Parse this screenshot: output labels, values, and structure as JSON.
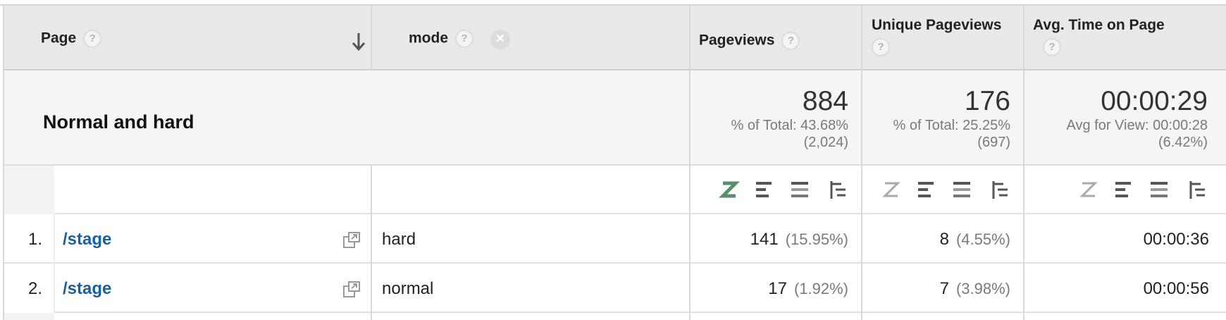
{
  "columns": {
    "page": "Page",
    "mode": "mode",
    "pageviews": "Pageviews",
    "unique_pageviews": "Unique Pageviews",
    "avg_time": "Avg. Time on Page",
    "help_glyph": "?",
    "close_glyph": "✕"
  },
  "summary": {
    "segment": "Normal and hard",
    "pageviews": {
      "value": "884",
      "line1": "% of Total: 43.68%",
      "line2": "(2,024)"
    },
    "unique_pageviews": {
      "value": "176",
      "line1": "% of Total: 25.25%",
      "line2": "(697)"
    },
    "avg_time": {
      "value": "00:00:29",
      "line1": "Avg for View: 00:00:28",
      "line2": "(6.42%)"
    }
  },
  "toolbar_icons": [
    "z-sparkline-icon",
    "bar-chart-icon",
    "comparison-icon",
    "pivot-icon"
  ],
  "rows": [
    {
      "num": "1.",
      "page": "/stage",
      "mode": "hard",
      "pageviews": "141",
      "pageviews_pct": "(15.95%)",
      "unique": "8",
      "unique_pct": "(4.55%)",
      "avg_time": "00:00:36"
    },
    {
      "num": "2.",
      "page": "/stage",
      "mode": "normal",
      "pageviews": "17",
      "pageviews_pct": "(1.92%)",
      "unique": "7",
      "unique_pct": "(3.98%)",
      "avg_time": "00:00:56"
    }
  ],
  "colors": {
    "link": "#1a5f9e",
    "header_bg": "#e9e9e9",
    "summary_bg": "#f5f5f5",
    "active_icon": "#3a7a52"
  }
}
